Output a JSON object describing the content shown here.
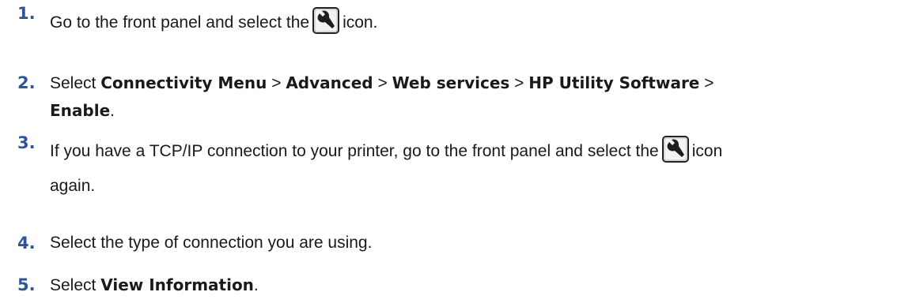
{
  "steps": [
    {
      "number": "1.",
      "parts": [
        "Go to the front panel and select the",
        "icon."
      ],
      "icon": "wrench-icon"
    },
    {
      "number": "2.",
      "parts": [
        "Select",
        "Connectivity Menu",
        ">",
        "Advanced",
        ">",
        "Web services",
        ">",
        "HP Utility Software",
        ">",
        "Enable",
        "."
      ]
    },
    {
      "number": "3.",
      "parts": [
        "If you have a TCP/IP connection to your printer, go to the front panel and select the",
        "icon",
        "again."
      ],
      "icon": "wrench-icon"
    },
    {
      "number": "4.",
      "parts": [
        "Select the type of connection you are using."
      ]
    },
    {
      "number": "5.",
      "parts": [
        "Select",
        "View Information",
        "."
      ]
    }
  ],
  "colors": {
    "step_number": "#2f5597",
    "text": "#1a1a1a"
  }
}
